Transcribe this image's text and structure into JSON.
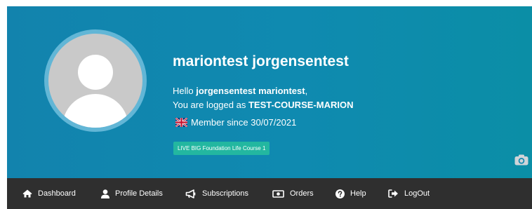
{
  "profile": {
    "name": "mariontest jorgensentest",
    "greeting_prefix": "Hello ",
    "greeting_name": "jorgensentest mariontest",
    "greeting_suffix": ",",
    "logged_prefix": "You are logged as ",
    "logged_user": "TEST-COURSE-MARION",
    "member_since": "Member since 30/07/2021",
    "course_badge": "LIVE BIG Foundation Life Course 1",
    "flag_icon": "uk-flag-icon",
    "avatar_icon": "user-placeholder-icon",
    "camera_icon": "camera-icon"
  },
  "colors": {
    "hero_bg": "#1283ad",
    "navbar_bg": "#2f2f2f",
    "badge_bg": "#23b7a0",
    "text": "#ffffff"
  },
  "nav": {
    "items": [
      {
        "label": "Dashboard",
        "icon": "home-icon"
      },
      {
        "label": "Profile Details",
        "icon": "user-icon"
      },
      {
        "label": "Subscriptions",
        "icon": "megaphone-icon"
      },
      {
        "label": "Orders",
        "icon": "money-bill-icon"
      },
      {
        "label": "Help",
        "icon": "question-circle-icon"
      },
      {
        "label": "LogOut",
        "icon": "sign-out-icon"
      }
    ]
  }
}
